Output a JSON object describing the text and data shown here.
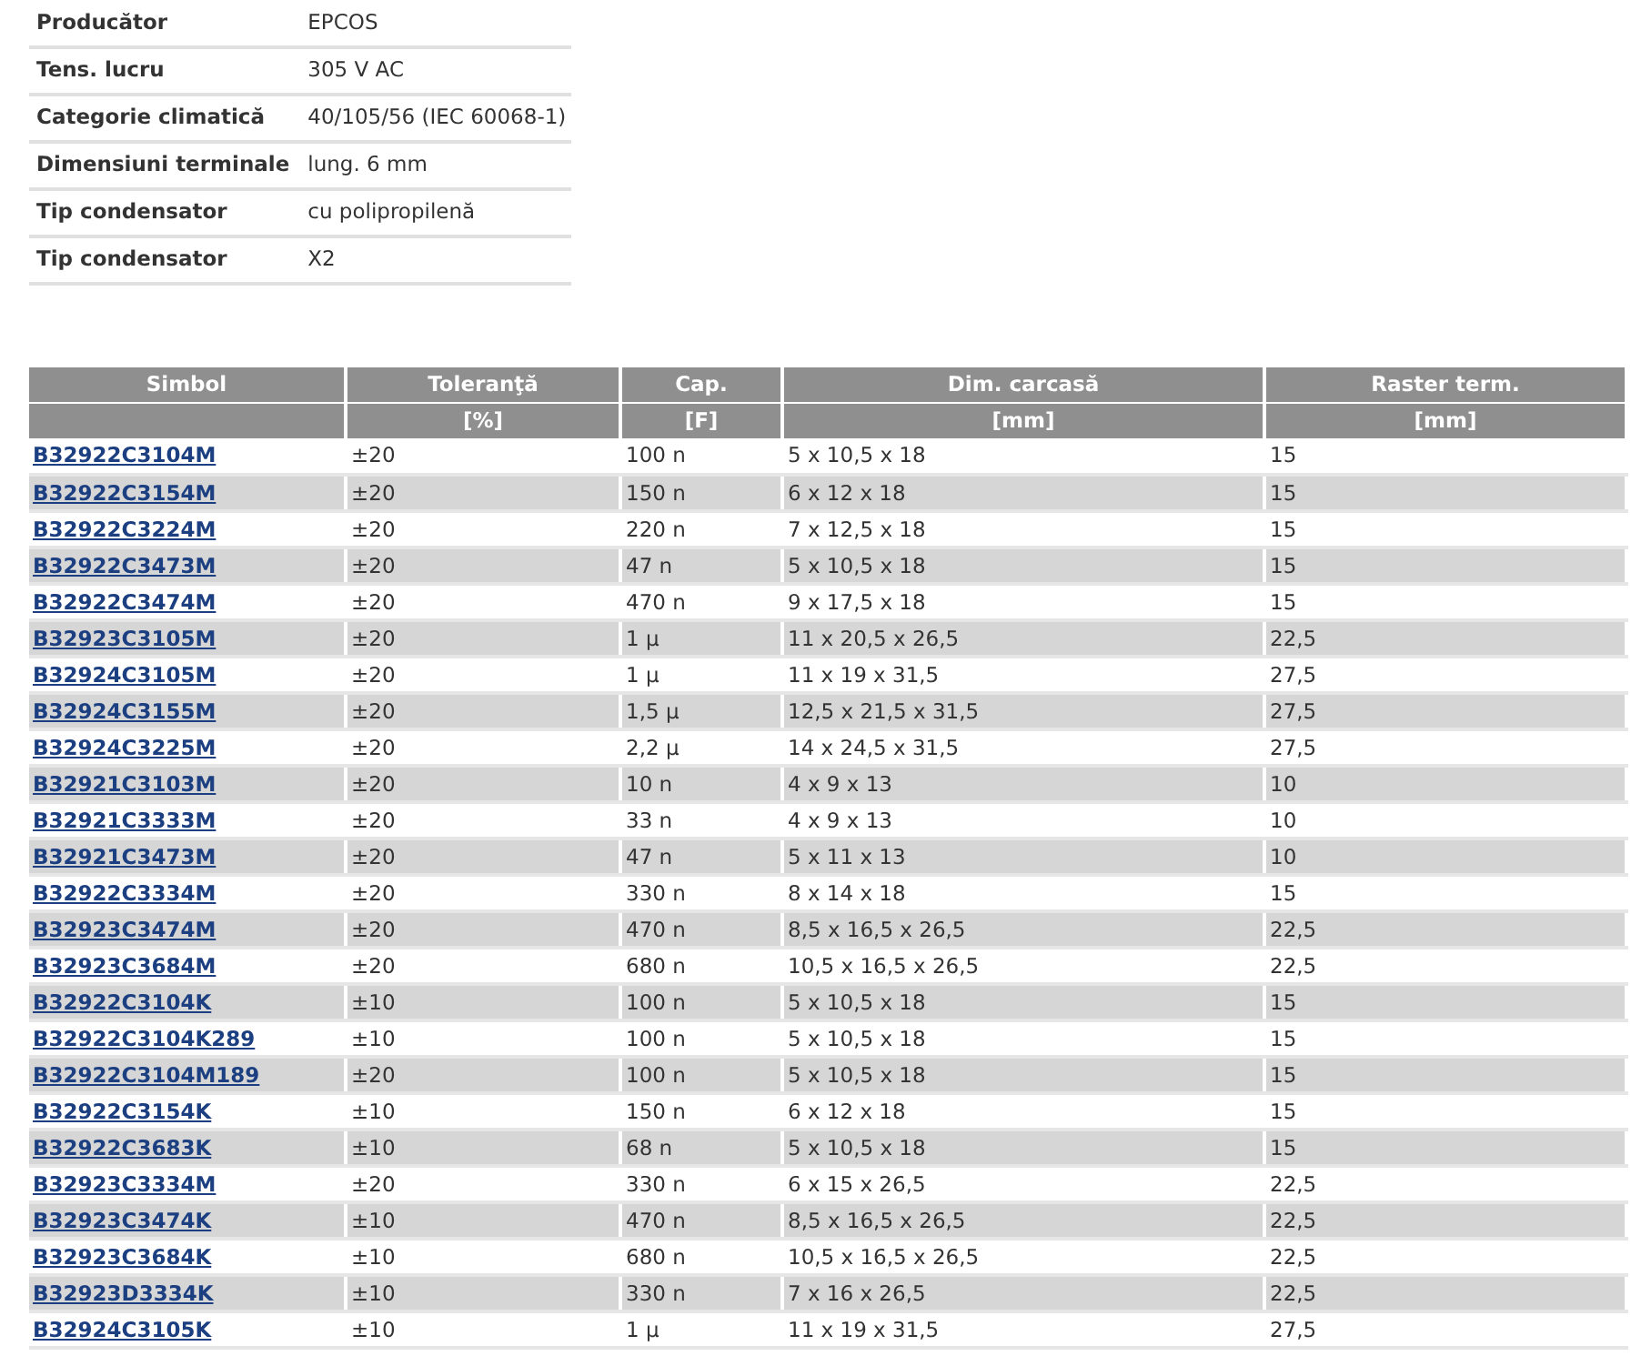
{
  "specs": [
    {
      "label": "Producător",
      "value": "EPCOS"
    },
    {
      "label": "Tens. lucru",
      "value": "305 V AC"
    },
    {
      "label": "Categorie climatică",
      "value": "40/105/56 (IEC 60068-1)"
    },
    {
      "label": "Dimensiuni terminale",
      "value": "lung. 6 mm"
    },
    {
      "label": "Tip condensator",
      "value": "cu polipropilenă"
    },
    {
      "label": "Tip condensator",
      "value": "X2"
    }
  ],
  "table": {
    "columns": [
      {
        "title": "Simbol"
      },
      {
        "title": "Toleranţă",
        "unit": "[%]"
      },
      {
        "title": "Cap.",
        "unit": "[F]"
      },
      {
        "title": "Dim. carcasă",
        "unit": "[mm]"
      },
      {
        "title": "Raster term.",
        "unit": "[mm]"
      }
    ],
    "rows": [
      [
        "B32922C3104M",
        "±20",
        "100 n",
        "5 x 10,5 x 18",
        "15"
      ],
      [
        "B32922C3154M",
        "±20",
        "150 n",
        "6 x 12 x 18",
        "15"
      ],
      [
        "B32922C3224M",
        "±20",
        "220 n",
        "7 x 12,5 x 18",
        "15"
      ],
      [
        "B32922C3473M",
        "±20",
        "47 n",
        "5 x 10,5 x 18",
        "15"
      ],
      [
        "B32922C3474M",
        "±20",
        "470 n",
        "9 x 17,5 x 18",
        "15"
      ],
      [
        "B32923C3105M",
        "±20",
        "1 µ",
        "11 x 20,5 x 26,5",
        "22,5"
      ],
      [
        "B32924C3105M",
        "±20",
        "1 µ",
        "11 x 19 x 31,5",
        "27,5"
      ],
      [
        "B32924C3155M",
        "±20",
        "1,5 µ",
        "12,5 x 21,5 x 31,5",
        "27,5"
      ],
      [
        "B32924C3225M",
        "±20",
        "2,2 µ",
        "14 x 24,5 x 31,5",
        "27,5"
      ],
      [
        "B32921C3103M",
        "±20",
        "10 n",
        "4 x 9 x 13",
        "10"
      ],
      [
        "B32921C3333M",
        "±20",
        "33 n",
        "4 x 9 x 13",
        "10"
      ],
      [
        "B32921C3473M",
        "±20",
        "47 n",
        "5 x 11 x 13",
        "10"
      ],
      [
        "B32922C3334M",
        "±20",
        "330 n",
        "8 x 14 x 18",
        "15"
      ],
      [
        "B32923C3474M",
        "±20",
        "470 n",
        "8,5 x 16,5 x 26,5",
        "22,5"
      ],
      [
        "B32923C3684M",
        "±20",
        "680 n",
        "10,5 x 16,5 x 26,5",
        "22,5"
      ],
      [
        "B32922C3104K",
        "±10",
        "100 n",
        "5 x 10,5 x 18",
        "15"
      ],
      [
        "B32922C3104K289",
        "±10",
        "100 n",
        "5 x 10,5 x 18",
        "15"
      ],
      [
        "B32922C3104M189",
        "±20",
        "100 n",
        "5 x 10,5 x 18",
        "15"
      ],
      [
        "B32922C3154K",
        "±10",
        "150 n",
        "6 x 12 x 18",
        "15"
      ],
      [
        "B32922C3683K",
        "±10",
        "68 n",
        "5 x 10,5 x 18",
        "15"
      ],
      [
        "B32923C3334M",
        "±20",
        "330 n",
        "6 x 15 x 26,5",
        "22,5"
      ],
      [
        "B32923C3474K",
        "±10",
        "470 n",
        "8,5 x 16,5 x 26,5",
        "22,5"
      ],
      [
        "B32923C3684K",
        "±10",
        "680 n",
        "10,5 x 16,5 x 26,5",
        "22,5"
      ],
      [
        "B32923D3334K",
        "±10",
        "330 n",
        "7 x 16 x 26,5",
        "22,5"
      ],
      [
        "B32924C3105K",
        "±10",
        "1 µ",
        "11 x 19 x 31,5",
        "27,5"
      ]
    ]
  }
}
